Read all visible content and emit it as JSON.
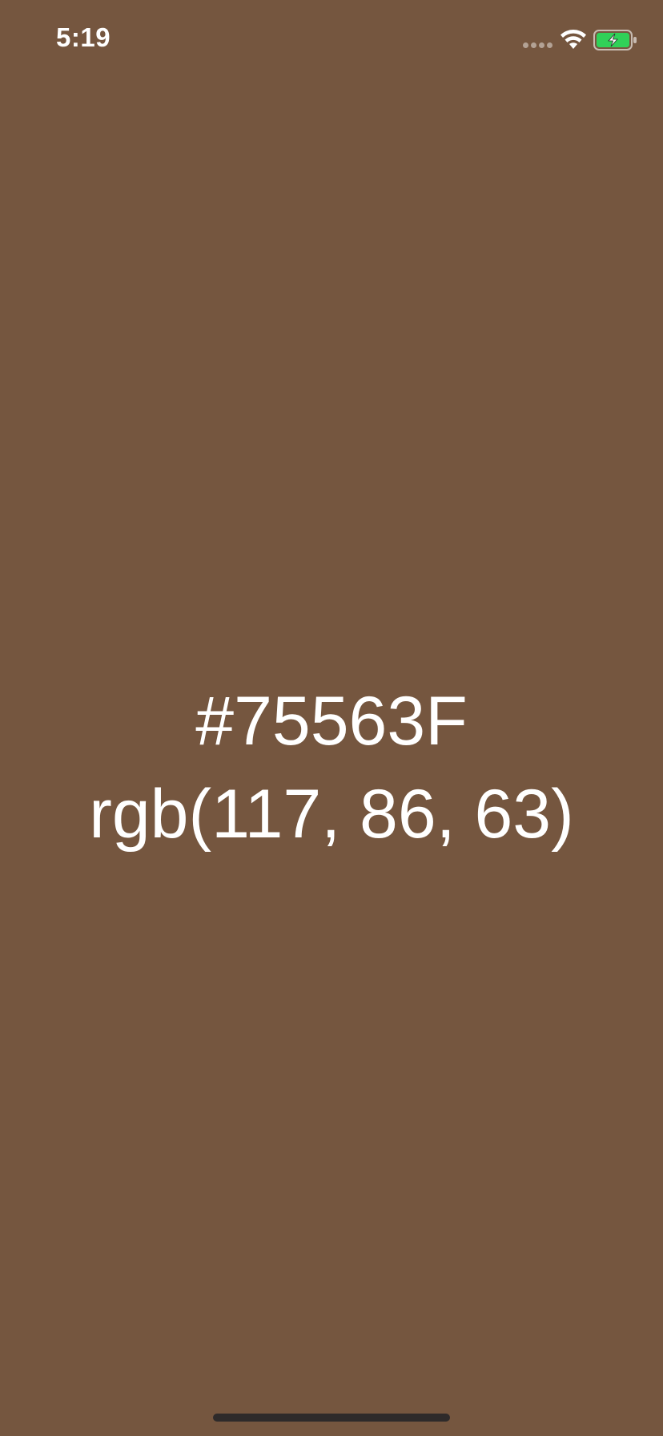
{
  "status_bar": {
    "time": "5:19",
    "icons": [
      "cellular-signal-icon",
      "wifi-icon",
      "battery-charging-icon"
    ],
    "battery_color": "#30d158"
  },
  "color_display": {
    "hex": "#75563F",
    "rgb": "rgb(117, 86, 63)",
    "background_color": "#75563F",
    "text_color": "#FFFFFF"
  }
}
